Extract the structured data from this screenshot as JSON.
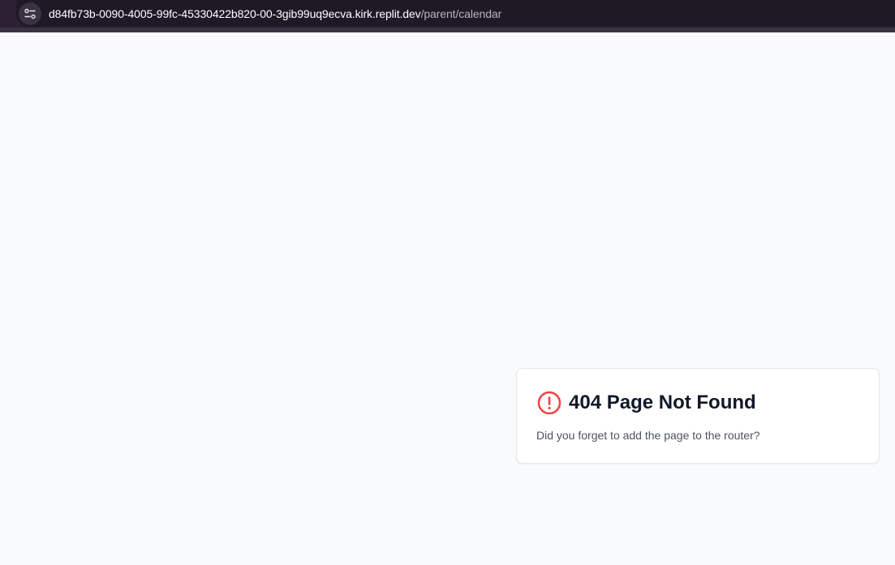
{
  "browser": {
    "url_host": "d84fb73b-0090-4005-99fc-45330422b820-00-3gib99uq9ecva.kirk.replit.dev",
    "url_path": "/parent/calendar",
    "site_info_icon": "tune-icon"
  },
  "error_card": {
    "icon": "alert-circle-icon",
    "title": "404 Page Not Found",
    "message": "Did you forget to add the page to the router?",
    "icon_color": "#ef4444"
  },
  "colors": {
    "page_background": "#f9fafb",
    "browser_chrome": "#2b2133",
    "title_text": "#111827",
    "body_text": "#4b5563"
  }
}
